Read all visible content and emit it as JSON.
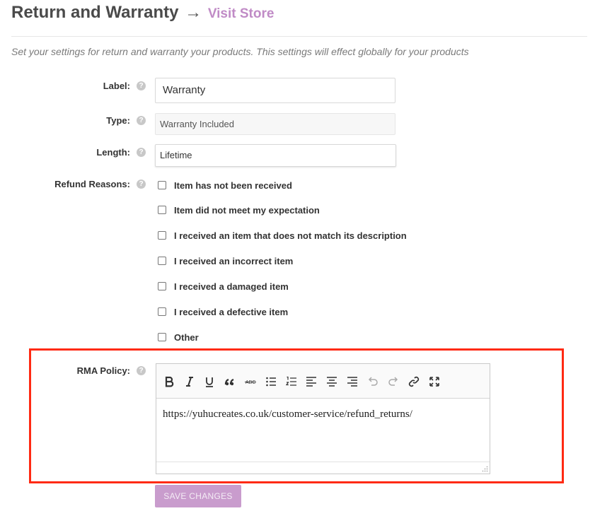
{
  "header": {
    "title": "Return and Warranty",
    "arrow": "→",
    "visit_store": "Visit Store",
    "description": "Set your settings for return and warranty your products. This settings will effect globally for your products"
  },
  "form": {
    "label": {
      "label": "Label:",
      "value": "Warranty"
    },
    "type": {
      "label": "Type:",
      "value": "Warranty Included"
    },
    "length": {
      "label": "Length:",
      "value": "Lifetime"
    },
    "refund_reasons": {
      "label": "Refund Reasons:",
      "options": [
        {
          "label": "Item has not been received",
          "checked": false
        },
        {
          "label": "Item did not meet my expectation",
          "checked": false
        },
        {
          "label": "I received an item that does not match its description",
          "checked": false
        },
        {
          "label": "I received an incorrect item",
          "checked": false
        },
        {
          "label": "I received a damaged item",
          "checked": false
        },
        {
          "label": "I received a defective item",
          "checked": false
        },
        {
          "label": "Other",
          "checked": false
        }
      ]
    },
    "rma_policy": {
      "label": "RMA Policy:",
      "content": "https://yuhucreates.co.uk/customer-service/refund_returns/",
      "toolbar": [
        "bold-icon",
        "italic-icon",
        "underline-icon",
        "blockquote-icon",
        "strikethrough-icon",
        "bullet-list-icon",
        "numbered-list-icon",
        "align-left-icon",
        "align-center-icon",
        "align-right-icon",
        "undo-icon",
        "redo-icon",
        "link-icon",
        "fullscreen-icon"
      ]
    },
    "save_label": "Save Changes"
  },
  "help_glyph": "?",
  "colors": {
    "accent": "#c08bc6",
    "save_button": "#c99ccd",
    "highlight": "#ff2a13"
  }
}
